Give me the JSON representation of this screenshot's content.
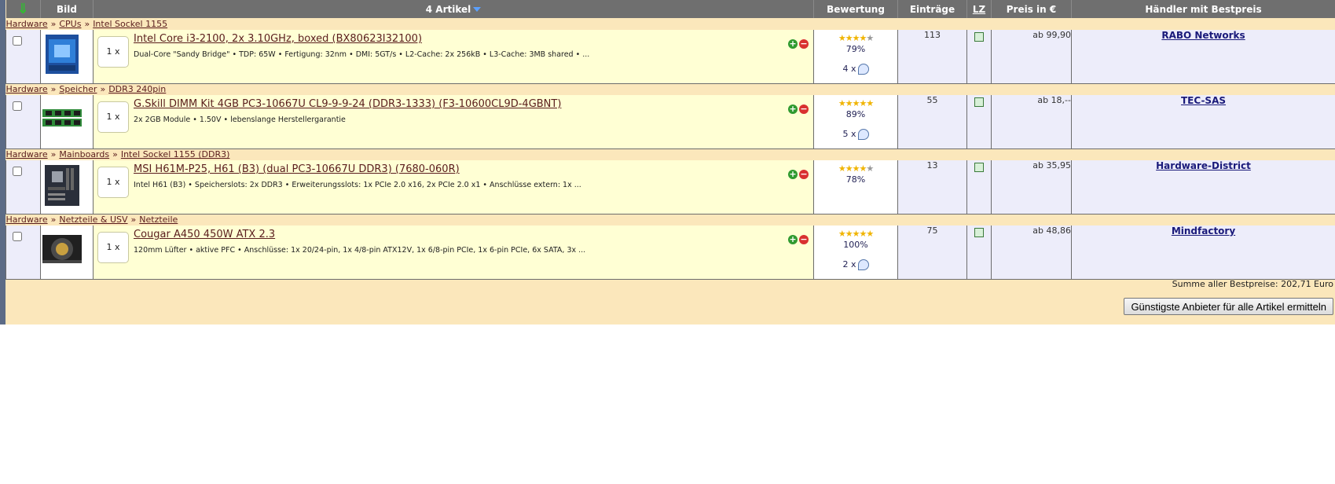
{
  "header": {
    "col_image": "Bild",
    "col_articles": "4 Artikel",
    "col_rating": "Bewertung",
    "col_entries": "Einträge",
    "col_lz": "LZ",
    "col_price": "Preis in €",
    "col_dealer": "Händler mit Bestpreis",
    "arrow": "⇓"
  },
  "items": [
    {
      "crumbs": [
        "Hardware",
        "CPUs",
        "Intel Sockel 1155"
      ],
      "qty": "1 x",
      "title": "Intel Core i3-2100, 2x 3.10GHz, boxed (BX80623I32100)",
      "desc": "Dual-Core \"Sandy Bridge\" • TDP: 65W • Fertigung: 32nm • DMI: 5GT/s • L2-Cache: 2x 256kB • L3-Cache: 3MB shared • ...",
      "stars": 4,
      "percent": "79%",
      "votes": "4 x",
      "entries": "113",
      "price": "ab 99,90",
      "dealer": "RABO Networks",
      "thumb": "cpu-box"
    },
    {
      "crumbs": [
        "Hardware",
        "Speicher",
        "DDR3 240pin"
      ],
      "qty": "1 x",
      "title": "G.Skill DIMM Kit 4GB PC3-10667U CL9-9-9-24 (DDR3-1333) (F3-10600CL9D-4GBNT)",
      "desc": "2x 2GB Module • 1.50V • lebenslange Herstellergarantie",
      "stars": 5,
      "percent": "89%",
      "votes": "5 x",
      "entries": "55",
      "price": "ab 18,--",
      "dealer": "TEC-SAS",
      "thumb": "ram"
    },
    {
      "crumbs": [
        "Hardware",
        "Mainboards",
        "Intel Sockel 1155 (DDR3)"
      ],
      "qty": "1 x",
      "title": "MSI H61M-P25, H61 (B3) (dual PC3-10667U DDR3) (7680-060R)",
      "desc": "Intel H61 (B3) • Speicherslots: 2x DDR3 • Erweiterungsslots: 1x PCIe 2.0 x16, 2x PCIe 2.0 x1 • Anschlüsse extern: 1x ...",
      "stars": 4,
      "percent": "78%",
      "votes": "",
      "entries": "13",
      "price": "ab 35,95",
      "dealer": "Hardware-District",
      "thumb": "mainboard"
    },
    {
      "crumbs": [
        "Hardware",
        "Netzteile & USV",
        "Netzteile"
      ],
      "qty": "1 x",
      "title": "Cougar A450 450W ATX 2.3",
      "desc": "120mm Lüfter • aktive PFC • Anschlüsse: 1x 20/24-pin, 1x 4/8-pin ATX12V, 1x 6/8-pin PCIe, 1x 6-pin PCIe, 6x SATA, 3x ...",
      "stars": 5,
      "percent": "100%",
      "votes": "2 x",
      "entries": "75",
      "price": "ab 48,86",
      "dealer": "Mindfactory",
      "thumb": "psu"
    }
  ],
  "summary": {
    "total_label": "Summe aller Bestpreise: 202,71 Euro",
    "cheapest_button": "Günstigste Anbieter für alle Artikel ermitteln"
  }
}
